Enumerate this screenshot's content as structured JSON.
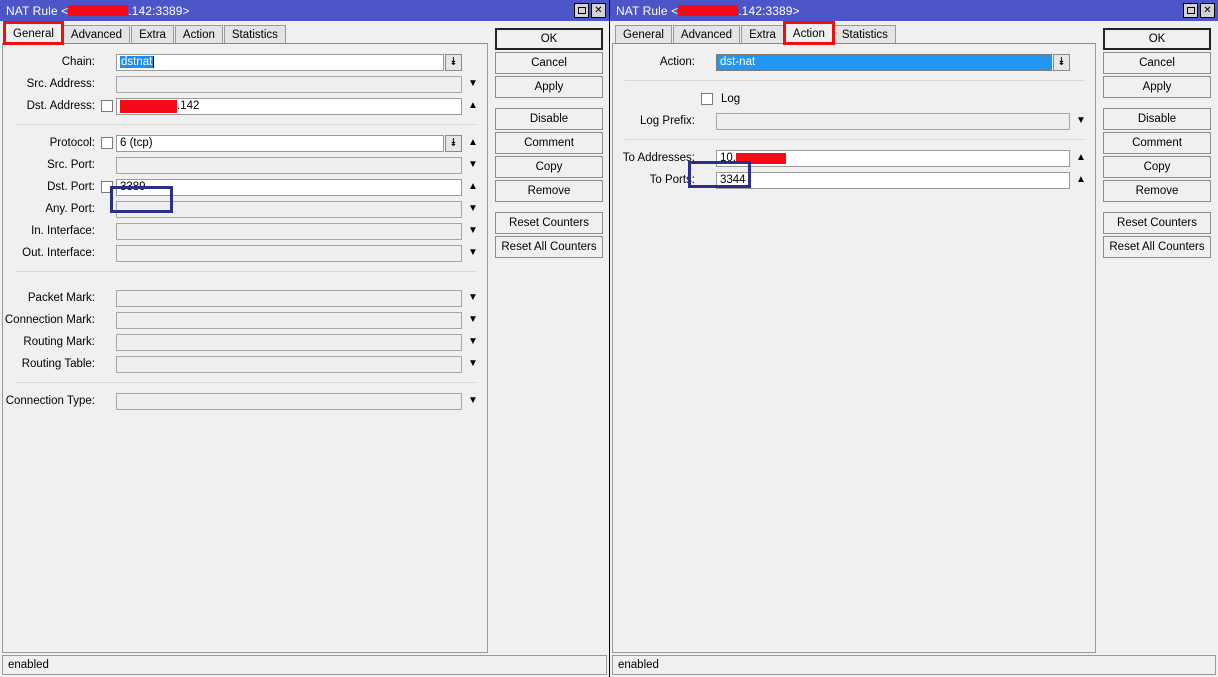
{
  "windows": [
    {
      "id": "left",
      "title_prefix": "NAT Rule <",
      "title_suffix": ".142:3389>",
      "active_tab": "General",
      "tabs": [
        {
          "label": "General"
        },
        {
          "label": "Advanced"
        },
        {
          "label": "Extra"
        },
        {
          "label": "Action"
        },
        {
          "label": "Statistics"
        }
      ],
      "fields": {
        "chain_label": "Chain:",
        "chain_value": "dstnat",
        "src_address_label": "Src. Address:",
        "src_address_value": "",
        "dst_address_label": "Dst. Address:",
        "dst_address_value": ".142",
        "protocol_label": "Protocol:",
        "protocol_value": "6 (tcp)",
        "src_port_label": "Src. Port:",
        "src_port_value": "",
        "dst_port_label": "Dst. Port:",
        "dst_port_value": "3389",
        "any_port_label": "Any. Port:",
        "any_port_value": "",
        "in_interface_label": "In. Interface:",
        "in_interface_value": "",
        "out_interface_label": "Out. Interface:",
        "out_interface_value": "",
        "packet_mark_label": "Packet Mark:",
        "packet_mark_value": "",
        "connection_mark_label": "Connection Mark:",
        "connection_mark_value": "",
        "routing_mark_label": "Routing Mark:",
        "routing_mark_value": "",
        "routing_table_label": "Routing Table:",
        "routing_table_value": "",
        "connection_type_label": "Connection Type:",
        "connection_type_value": ""
      },
      "buttons": [
        "OK",
        "Cancel",
        "Apply",
        "Disable",
        "Comment",
        "Copy",
        "Remove",
        "Reset Counters",
        "Reset All Counters"
      ],
      "status": "enabled"
    },
    {
      "id": "right",
      "title_prefix": "NAT Rule <",
      "title_suffix": ".142:3389>",
      "active_tab": "Action",
      "tabs": [
        {
          "label": "General"
        },
        {
          "label": "Advanced"
        },
        {
          "label": "Extra"
        },
        {
          "label": "Action"
        },
        {
          "label": "Statistics"
        }
      ],
      "fields": {
        "action_label": "Action:",
        "action_value": "dst-nat",
        "log_label": "Log",
        "log_checked": false,
        "log_prefix_label": "Log Prefix:",
        "log_prefix_value": "",
        "to_addresses_label": "To Addresses:",
        "to_addresses_value": "10.",
        "to_ports_label": "To Ports:",
        "to_ports_value": "3344"
      },
      "buttons": [
        "OK",
        "Cancel",
        "Apply",
        "Disable",
        "Comment",
        "Copy",
        "Remove",
        "Reset Counters",
        "Reset All Counters"
      ],
      "status": "enabled"
    }
  ],
  "colors": {
    "titlebar": "#4d56c8",
    "redaction": "#f40b18",
    "tab_highlight": "#ef0f13",
    "field_highlight": "#2c2f87",
    "selection": "#2196f3"
  },
  "icons": {
    "maximize": "maximize-icon",
    "close": "close-icon",
    "dropdown": "dropdown-arrow-icon",
    "expand_up": "expand-up-icon",
    "expand_down": "expand-down-icon"
  }
}
